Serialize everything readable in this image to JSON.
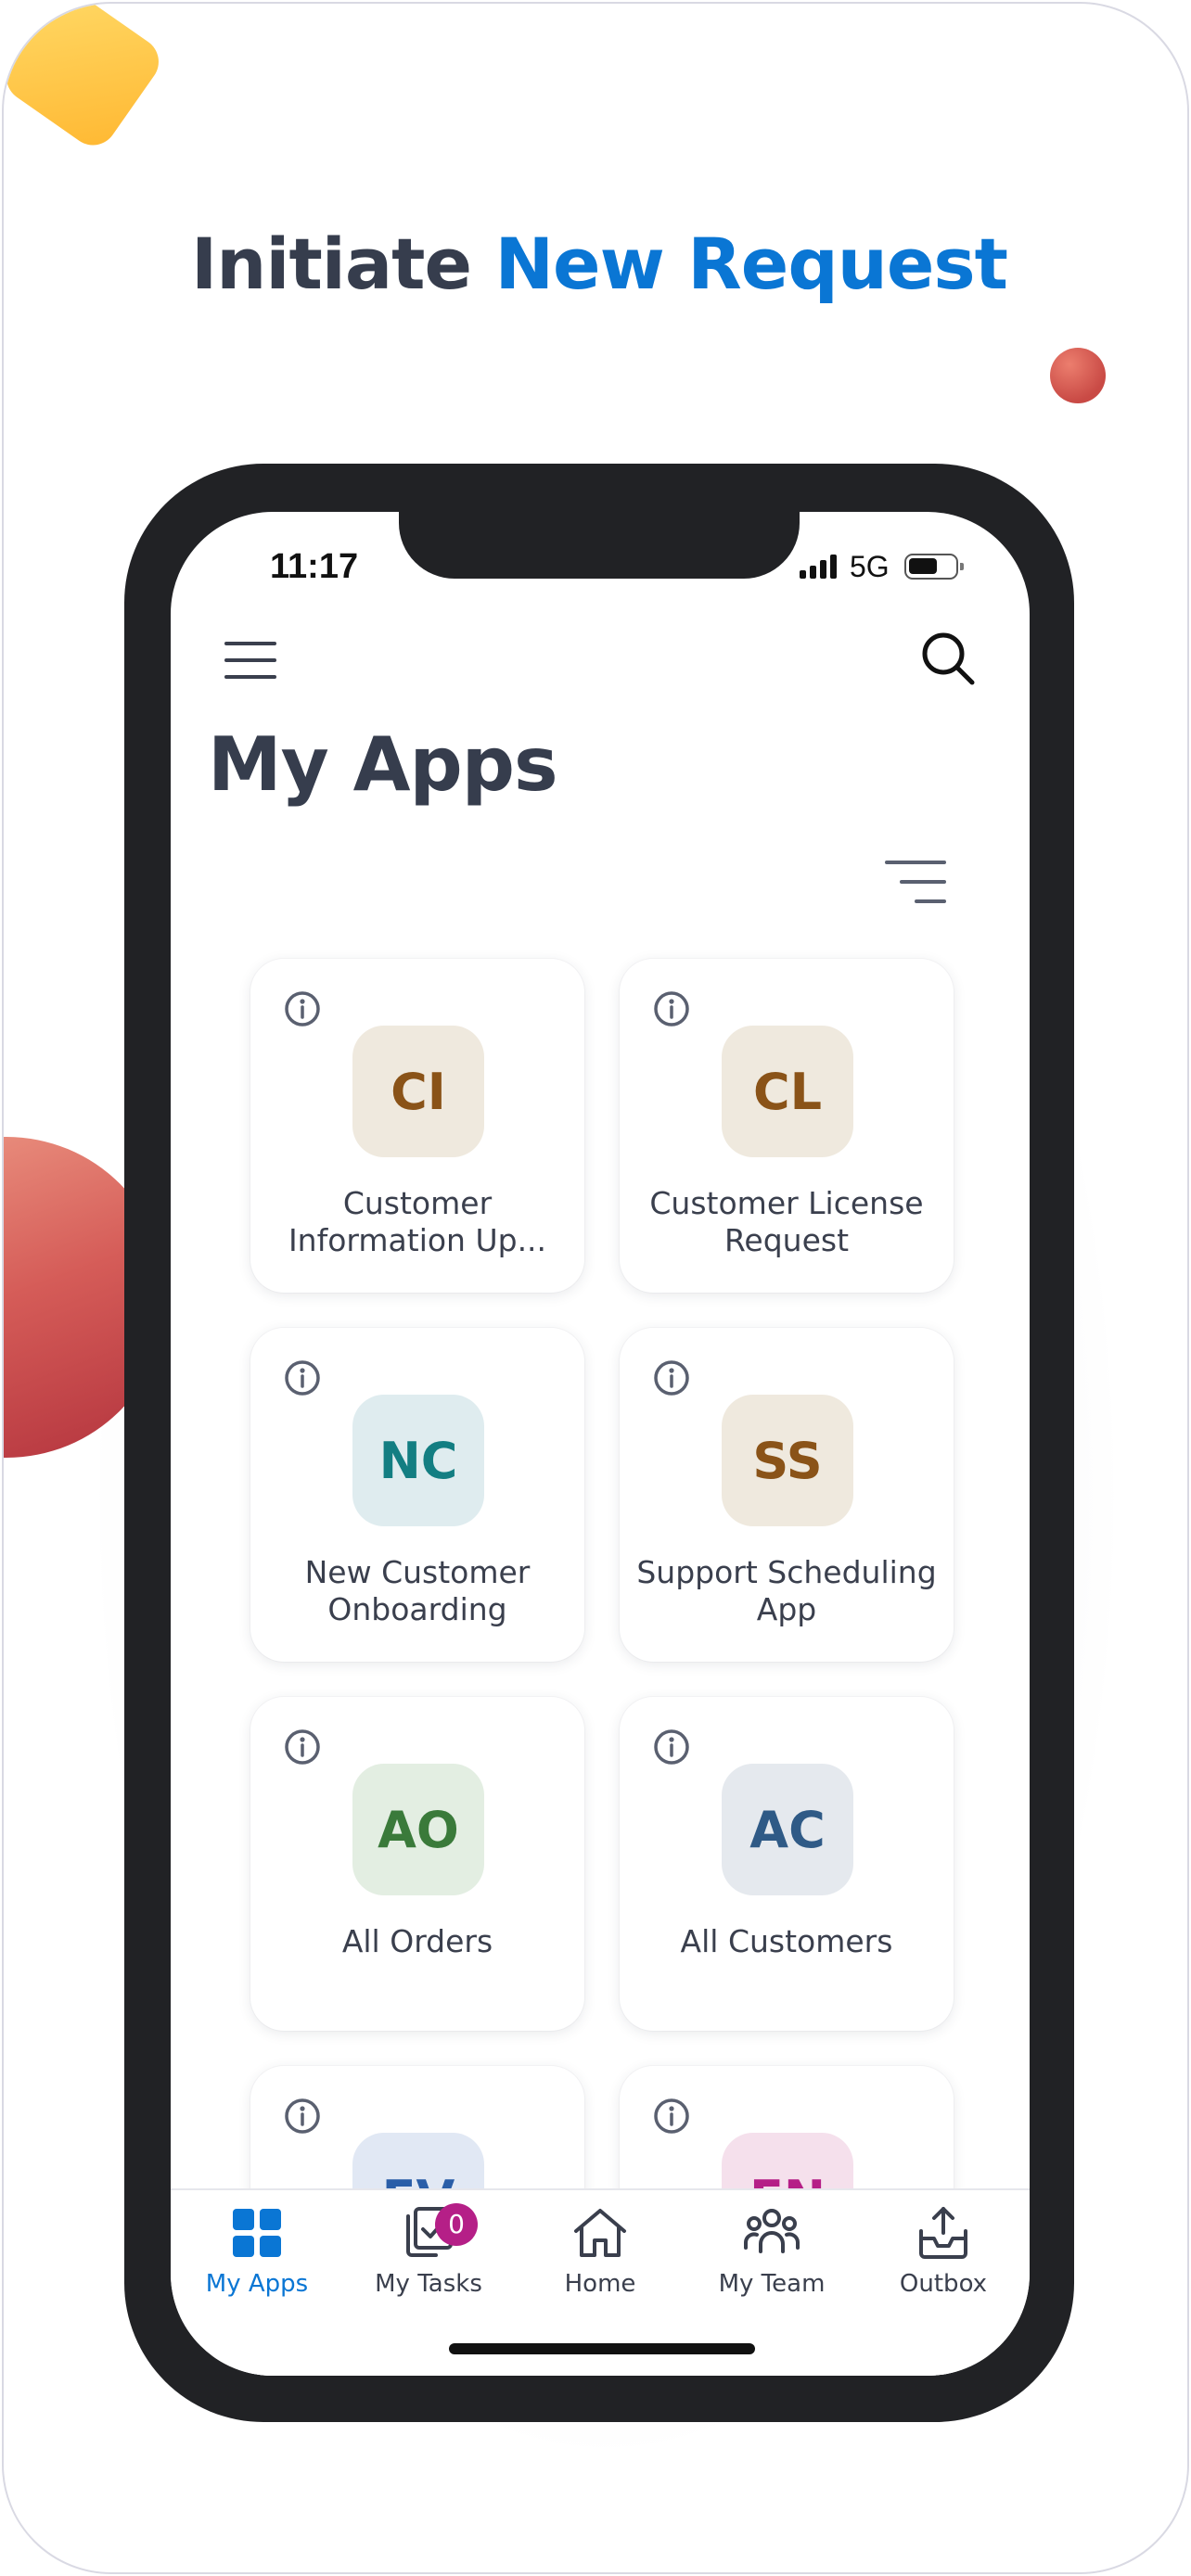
{
  "headline": {
    "part1": "Initiate ",
    "part2": "New Request"
  },
  "status_bar": {
    "time": "11:17",
    "network": "5G"
  },
  "header": {
    "title": "My Apps"
  },
  "apps": [
    {
      "initials": "CI",
      "label": "Customer Information Up...",
      "tile_bg": "#efe9de",
      "tile_fg": "#8a5318"
    },
    {
      "initials": "CL",
      "label": "Customer License Request",
      "tile_bg": "#efe9de",
      "tile_fg": "#8a5318"
    },
    {
      "initials": "NC",
      "label": "New Customer Onboarding",
      "tile_bg": "#dfecef",
      "tile_fg": "#137e82"
    },
    {
      "initials": "SS",
      "label": "Support Scheduling App",
      "tile_bg": "#efe9de",
      "tile_fg": "#8a5318"
    },
    {
      "initials": "AO",
      "label": "All Orders",
      "tile_bg": "#e3eee2",
      "tile_fg": "#3a7a3a"
    },
    {
      "initials": "AC",
      "label": "All Customers",
      "tile_bg": "#e5e9ee",
      "tile_fg": "#2f5a86"
    },
    {
      "initials": "EV",
      "label": "",
      "tile_bg": "#e1e8f4",
      "tile_fg": "#2a5ea8"
    },
    {
      "initials": "EN",
      "label": "",
      "tile_bg": "#f5e0ec",
      "tile_fg": "#b51f87"
    }
  ],
  "tabs": [
    {
      "label": "My Apps",
      "icon": "grid-icon",
      "active": true
    },
    {
      "label": "My Tasks",
      "icon": "tasks-icon",
      "badge": "0"
    },
    {
      "label": "Home",
      "icon": "home-icon"
    },
    {
      "label": "My Team",
      "icon": "team-icon"
    },
    {
      "label": "Outbox",
      "icon": "outbox-icon"
    }
  ],
  "colors": {
    "accent": "#0a76d4",
    "title": "#363d4d",
    "badge": "#b51f87"
  }
}
